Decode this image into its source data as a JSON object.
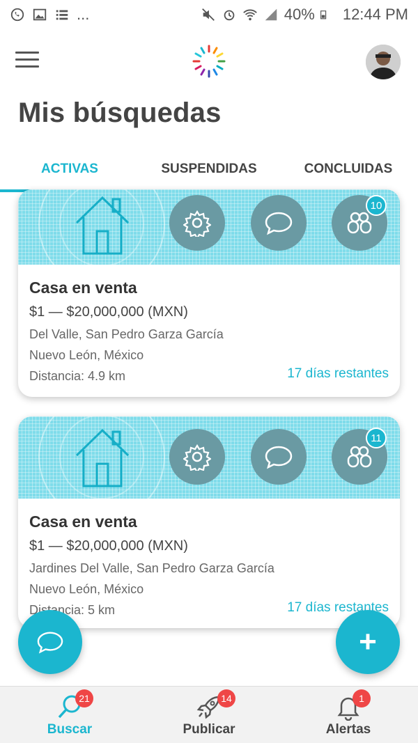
{
  "status_bar": {
    "left_icons": [
      "whatsapp-icon",
      "image-icon",
      "list-icon"
    ],
    "ellipsis": "...",
    "battery": "40%",
    "time": "12:44 PM"
  },
  "header": {
    "title": "Mis búsquedas"
  },
  "tabs": [
    {
      "label": "ACTIVAS",
      "active": true
    },
    {
      "label": "SUSPENDIDAS",
      "active": false
    },
    {
      "label": "CONCLUIDAS",
      "active": false
    }
  ],
  "cards": [
    {
      "title": "Casa en venta",
      "price": "$1 — $20,000,000 (MXN)",
      "location_line1": "Del Valle, San Pedro Garza García",
      "location_line2": "Nuevo León, México",
      "distance": "Distancia: 4.9 km",
      "days_left": "17 días restantes",
      "matches_badge": "10"
    },
    {
      "title": "Casa en venta",
      "price": "$1 — $20,000,000 (MXN)",
      "location_line1": "Jardines Del Valle, San Pedro Garza García",
      "location_line2": "Nuevo León, México",
      "distance": "Distancia: 5 km",
      "days_left": "17 días restantes",
      "matches_badge": "11"
    }
  ],
  "fab": {
    "add_label": "+"
  },
  "bottom_nav": [
    {
      "label": "Buscar",
      "badge": "21",
      "icon": "search-icon",
      "active": true
    },
    {
      "label": "Publicar",
      "badge": "14",
      "icon": "rocket-icon",
      "active": false
    },
    {
      "label": "Alertas",
      "badge": "1",
      "icon": "bell-icon",
      "active": false
    }
  ],
  "colors": {
    "accent": "#1bb6cf",
    "badge_red": "#ef4646",
    "circle_btn": "#6a9aa3"
  }
}
